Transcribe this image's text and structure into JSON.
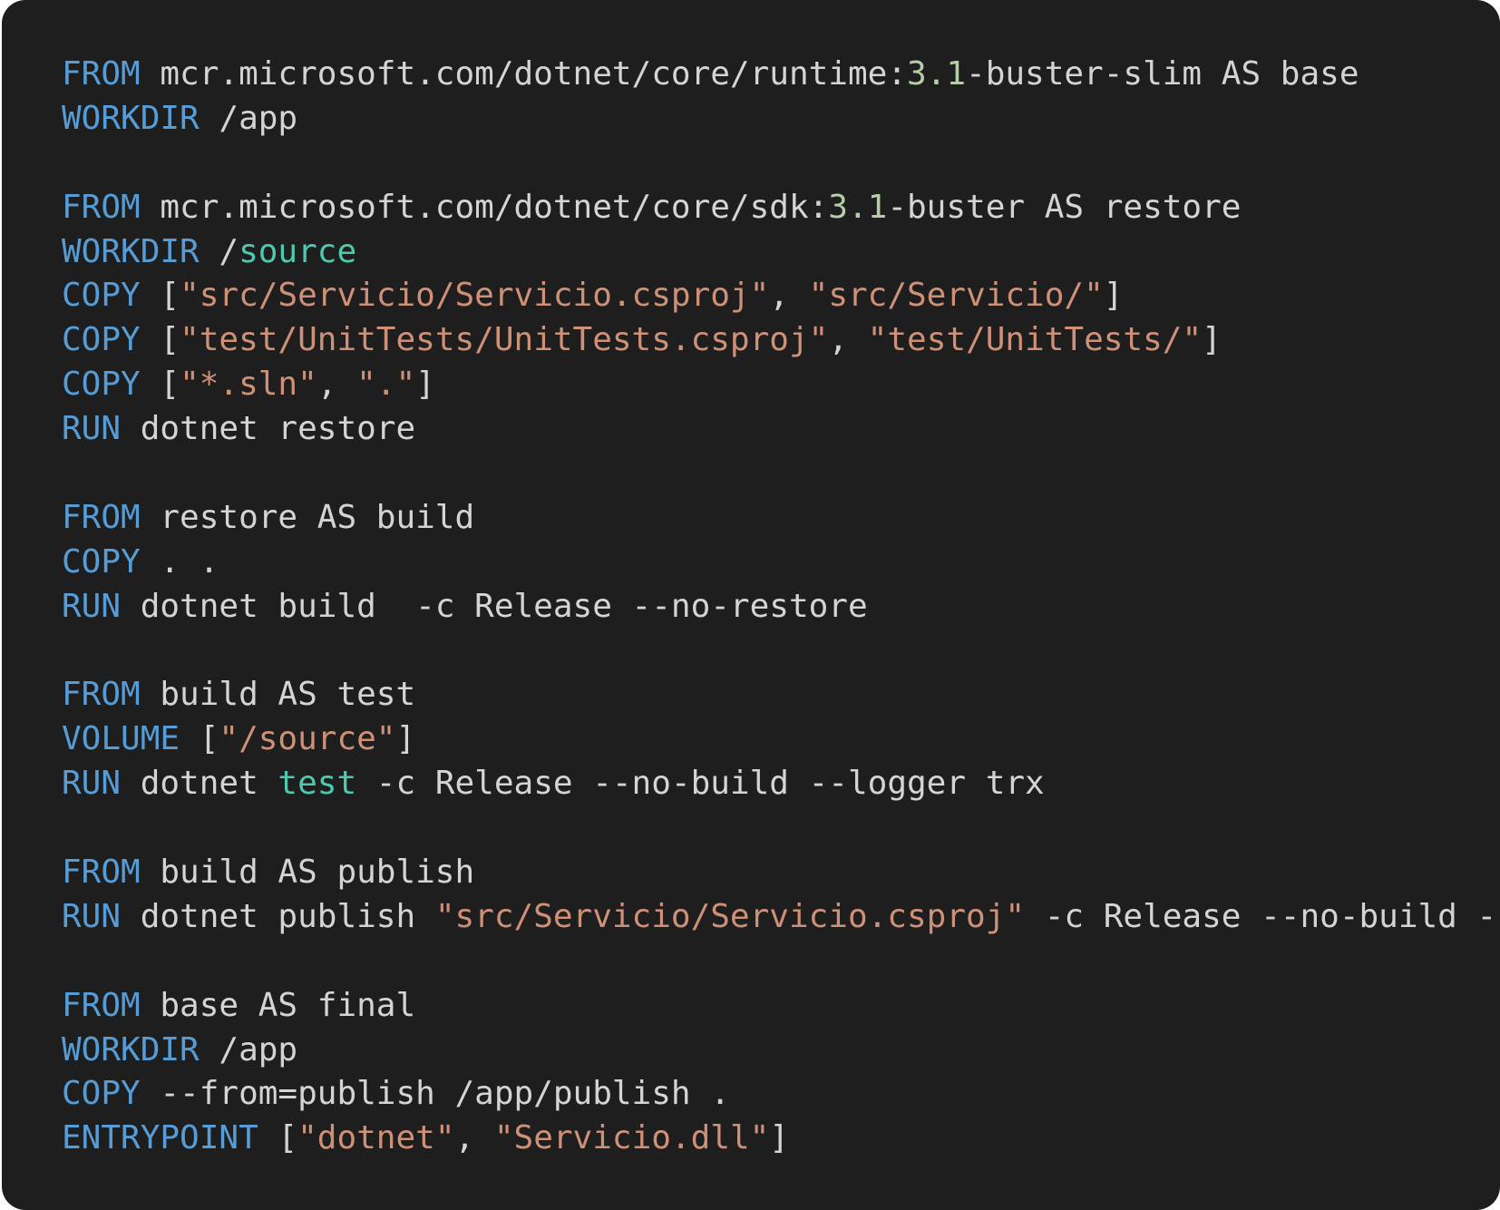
{
  "theme": {
    "background": "#1e1e1e",
    "keyword": "#569cd6",
    "string": "#ce9178",
    "number": "#b5cea8",
    "builtin": "#4ec9b0",
    "text": "#d4d4d4"
  },
  "code": {
    "language": "dockerfile",
    "lines": [
      [
        {
          "t": "keyword",
          "v": "FROM"
        },
        {
          "t": "text",
          "v": " mcr.microsoft.com/dotnet/core/runtime:"
        },
        {
          "t": "number",
          "v": "3.1"
        },
        {
          "t": "text",
          "v": "-buster-slim AS base"
        }
      ],
      [
        {
          "t": "keyword",
          "v": "WORKDIR"
        },
        {
          "t": "text",
          "v": " /app"
        }
      ],
      [],
      [
        {
          "t": "keyword",
          "v": "FROM"
        },
        {
          "t": "text",
          "v": " mcr.microsoft.com/dotnet/core/sdk:"
        },
        {
          "t": "number",
          "v": "3.1"
        },
        {
          "t": "text",
          "v": "-buster AS restore"
        }
      ],
      [
        {
          "t": "keyword",
          "v": "WORKDIR"
        },
        {
          "t": "text",
          "v": " /"
        },
        {
          "t": "builtin",
          "v": "source"
        }
      ],
      [
        {
          "t": "keyword",
          "v": "COPY"
        },
        {
          "t": "text",
          "v": " ["
        },
        {
          "t": "string",
          "v": "\"src/Servicio/Servicio.csproj\""
        },
        {
          "t": "text",
          "v": ", "
        },
        {
          "t": "string",
          "v": "\"src/Servicio/\""
        },
        {
          "t": "text",
          "v": "]"
        }
      ],
      [
        {
          "t": "keyword",
          "v": "COPY"
        },
        {
          "t": "text",
          "v": " ["
        },
        {
          "t": "string",
          "v": "\"test/UnitTests/UnitTests.csproj\""
        },
        {
          "t": "text",
          "v": ", "
        },
        {
          "t": "string",
          "v": "\"test/UnitTests/\""
        },
        {
          "t": "text",
          "v": "]"
        }
      ],
      [
        {
          "t": "keyword",
          "v": "COPY"
        },
        {
          "t": "text",
          "v": " ["
        },
        {
          "t": "string",
          "v": "\"*.sln\""
        },
        {
          "t": "text",
          "v": ", "
        },
        {
          "t": "string",
          "v": "\".\""
        },
        {
          "t": "text",
          "v": "]"
        }
      ],
      [
        {
          "t": "keyword",
          "v": "RUN"
        },
        {
          "t": "text",
          "v": " dotnet restore"
        }
      ],
      [],
      [
        {
          "t": "keyword",
          "v": "FROM"
        },
        {
          "t": "text",
          "v": " restore AS build"
        }
      ],
      [
        {
          "t": "keyword",
          "v": "COPY"
        },
        {
          "t": "text",
          "v": " . ."
        }
      ],
      [
        {
          "t": "keyword",
          "v": "RUN"
        },
        {
          "t": "text",
          "v": " dotnet build  -c Release --no-restore"
        }
      ],
      [],
      [
        {
          "t": "keyword",
          "v": "FROM"
        },
        {
          "t": "text",
          "v": " build AS test"
        }
      ],
      [
        {
          "t": "keyword",
          "v": "VOLUME"
        },
        {
          "t": "text",
          "v": " ["
        },
        {
          "t": "string",
          "v": "\"/source\""
        },
        {
          "t": "text",
          "v": "]"
        }
      ],
      [
        {
          "t": "keyword",
          "v": "RUN"
        },
        {
          "t": "text",
          "v": " dotnet "
        },
        {
          "t": "builtin",
          "v": "test"
        },
        {
          "t": "text",
          "v": " -c Release --no-build --logger trx"
        }
      ],
      [],
      [
        {
          "t": "keyword",
          "v": "FROM"
        },
        {
          "t": "text",
          "v": " build AS publish"
        }
      ],
      [
        {
          "t": "keyword",
          "v": "RUN"
        },
        {
          "t": "text",
          "v": " dotnet publish "
        },
        {
          "t": "string",
          "v": "\"src/Servicio/Servicio.csproj\""
        },
        {
          "t": "text",
          "v": " -c Release --no-build -"
        }
      ],
      [],
      [
        {
          "t": "keyword",
          "v": "FROM"
        },
        {
          "t": "text",
          "v": " base AS final"
        }
      ],
      [
        {
          "t": "keyword",
          "v": "WORKDIR"
        },
        {
          "t": "text",
          "v": " /app"
        }
      ],
      [
        {
          "t": "keyword",
          "v": "COPY"
        },
        {
          "t": "text",
          "v": " --from=publish /app/publish ."
        }
      ],
      [
        {
          "t": "keyword",
          "v": "ENTRYPOINT"
        },
        {
          "t": "text",
          "v": " ["
        },
        {
          "t": "string",
          "v": "\"dotnet\""
        },
        {
          "t": "text",
          "v": ", "
        },
        {
          "t": "string",
          "v": "\"Servicio.dll\""
        },
        {
          "t": "text",
          "v": "]"
        }
      ]
    ]
  }
}
